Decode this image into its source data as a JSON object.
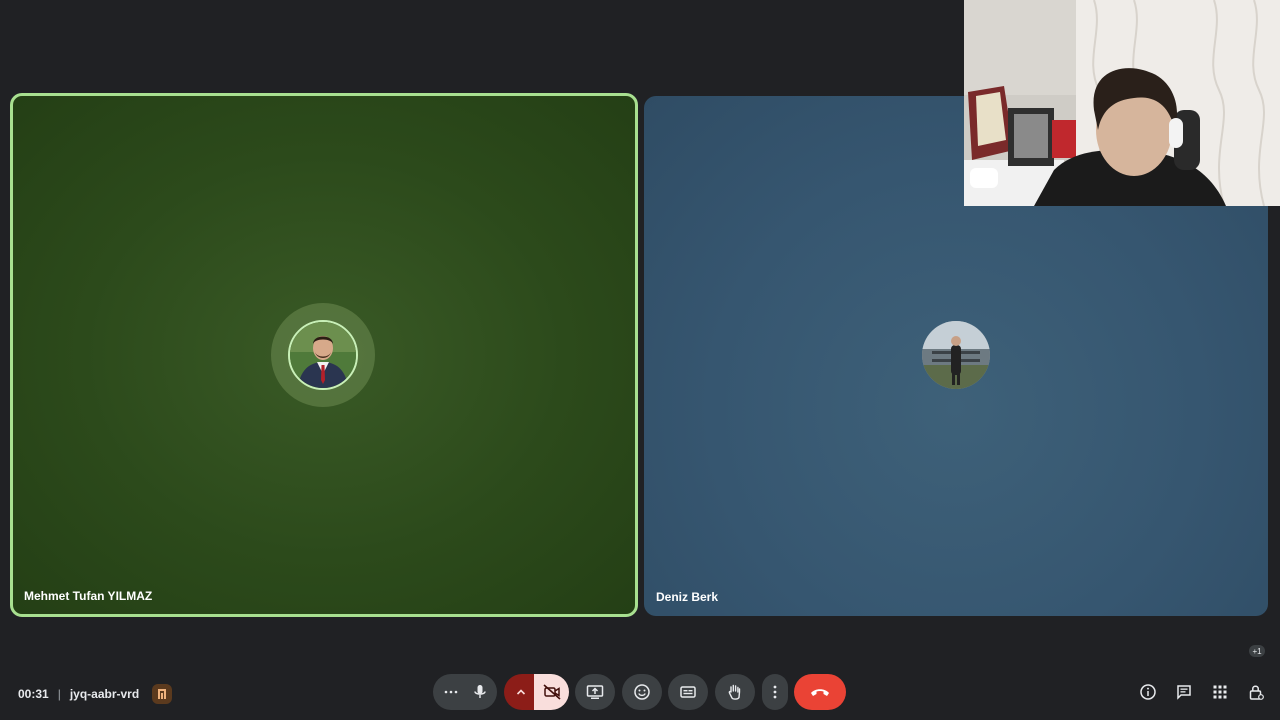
{
  "participants": [
    {
      "name": "Mehmet Tufan YILMAZ",
      "speaking": true,
      "tile_color": "#2c4a1b"
    },
    {
      "name": "Deniz Berk",
      "speaking": false,
      "tile_color": "#365670"
    }
  ],
  "meeting": {
    "time": "00:31",
    "separator": "|",
    "code": "jyq-aabr-vrd"
  },
  "overflow": {
    "label": "+1"
  },
  "controls": {
    "more_options": "more-horiz-icon",
    "mic": "mic-icon",
    "camera_options": "chevron-up-icon",
    "camera": "videocam-off-icon",
    "present": "present-icon",
    "reactions": "emoji-icon",
    "captions": "captions-icon",
    "raise_hand": "hand-icon",
    "more": "more-vert-icon",
    "leave": "call-end-icon"
  },
  "right_panel": [
    "info-icon",
    "chat-icon",
    "activities-icon",
    "host-controls-icon"
  ],
  "colors": {
    "background": "#202124",
    "speaking_border": "#a8e090",
    "leave": "#ea4335",
    "camera_off_bg": "#f9dedc",
    "camera_arrow_bg": "#8c1d18"
  }
}
